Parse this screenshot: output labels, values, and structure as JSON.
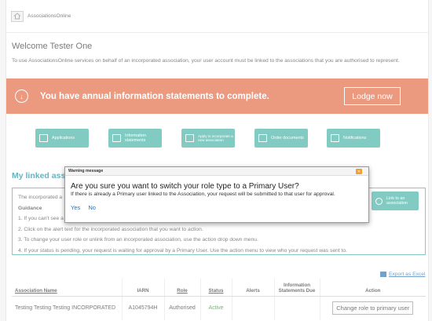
{
  "header": {
    "brand": "AssociationsOnline",
    "home_icon": "home-icon"
  },
  "welcome": {
    "title": "Welcome Tester One",
    "text": "To use AssociationsOnline services on behalf of an incorporated association, your user account must be linked to the associations that you are authorised to represent."
  },
  "banner": {
    "icon": "alert-icon",
    "message": "You have annual information statements to complete.",
    "button": "Lodge now",
    "color": "#e0653d"
  },
  "tiles": [
    {
      "label": "Applications",
      "icon": "applications-icon"
    },
    {
      "label": "Information statements",
      "icon": "information-statements-icon"
    },
    {
      "label": "Apply to incorporate a new association",
      "icon": "apply-incorporate-icon"
    },
    {
      "label": "Order documents",
      "icon": "order-documents-icon"
    },
    {
      "label": "Notifications",
      "icon": "notifications-icon"
    }
  ],
  "linked": {
    "title_visible": "My linked asso",
    "link_tile": "Link to an association",
    "guide_intro": "The incorporated a",
    "guidance_label": "Guidance",
    "guide_1": "1. If you can't see a",
    "guide_2": "2. Click on the alert text for the incorporated association that you want to action.",
    "guide_3": "3. To change your user role or unlink from an incorporated association, use the action drop down menu.",
    "guide_4": "4. If your status is pending, your request is waiting for approval by a Primary User. Use the action menu to view who your request was sent to."
  },
  "export_label": "Export as Excel",
  "table": {
    "headers": {
      "name": "Association Name",
      "iarn": "IARN",
      "role": "Role",
      "status": "Status",
      "alerts": "Alerts",
      "info": "Information Statements Due",
      "action": "Action"
    },
    "rows": [
      {
        "name": "Testing Testing Testing INCORPORATED",
        "iarn": "A1045794H",
        "role": "Authorised",
        "status": "Active",
        "alerts": "",
        "info": "",
        "action": "Change role to primary user"
      }
    ]
  },
  "dialog": {
    "title": "Warning message",
    "question": "Are you sure you want to switch your role type to a Primary User?",
    "detail": "If there is already a Primary user linked to the Association, your request will be submitted to that user for approval.",
    "yes": "Yes",
    "no": "No",
    "close_icon": "close-icon"
  },
  "colors": {
    "teal": "#3fb0a3",
    "heading": "#1a8a9a",
    "active": "#2e8b2e",
    "link": "#2a6fb0"
  }
}
